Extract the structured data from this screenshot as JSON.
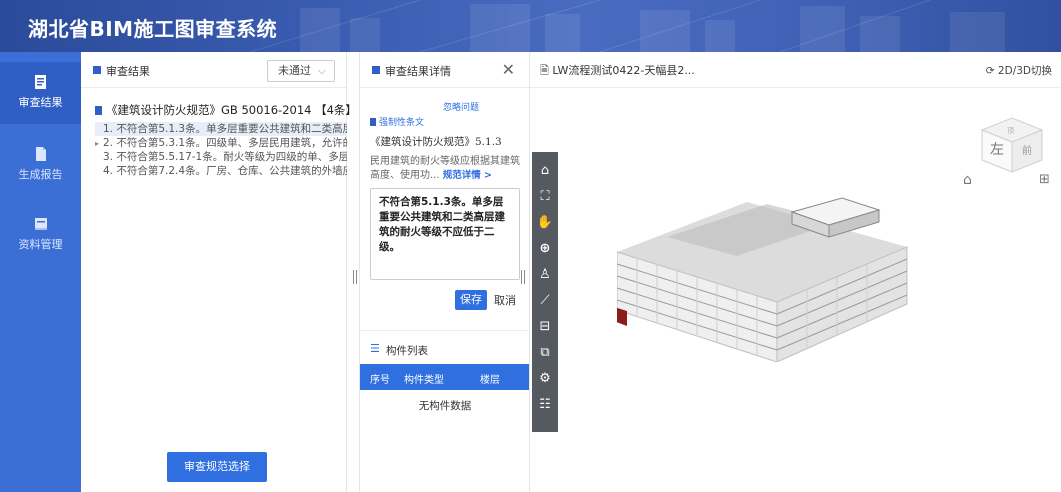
{
  "app": {
    "title": "湖北省BIM施工图审查系统"
  },
  "nav": {
    "items": [
      {
        "label": "审查结果",
        "icon": "review-icon",
        "active": true
      },
      {
        "label": "生成报告",
        "icon": "report-icon",
        "active": false
      },
      {
        "label": "资料管理",
        "icon": "data-icon",
        "active": false
      }
    ]
  },
  "results_panel": {
    "title": "审查结果",
    "status_select": {
      "value": "未通过"
    },
    "standard": "《建筑设计防火规范》GB 50016-2014 【4条】",
    "issues": [
      "1. 不符合第5.1.3条。单多层重要公共建筑和二类高层...",
      "2. 不符合第5.3.1条。四级单、多层民用建筑，允许的...",
      "3. 不符合第5.5.17-1条。耐火等级为四级的单、多层...",
      "4. 不符合第7.2.4条。厂房、仓库、公共建筑的外墙应..."
    ],
    "select_standard_button": "审查规范选择"
  },
  "detail_panel": {
    "title": "审查结果详情",
    "ignore_link": "忽略问题",
    "mandatory_label": "强制性条文",
    "clause": "《建筑设计防火规范》5.1.3",
    "clause_desc": "民用建筑的耐火等级应根据其建筑高度、使用功...",
    "detail_link": "规范详情 >",
    "editor_text": "不符合第5.1.3条。单多层重要公共建筑和二类高层建筑的耐火等级不应低于二级。",
    "save_button": "保存",
    "cancel_button": "取消",
    "components": {
      "title": "构件列表",
      "columns": [
        "序号",
        "构件类型",
        "楼层"
      ],
      "empty_text": "无构件数据"
    }
  },
  "view_panel": {
    "doc_title": "LW流程测试0422-天幅县2...",
    "toggle_label": "2D/3D切换",
    "cube_labels": {
      "left": "左",
      "front": "前",
      "top": "顶"
    }
  },
  "colors": {
    "primary": "#2f6fe0",
    "nav": "#3b6fd6",
    "header": "#3a5cb0"
  }
}
